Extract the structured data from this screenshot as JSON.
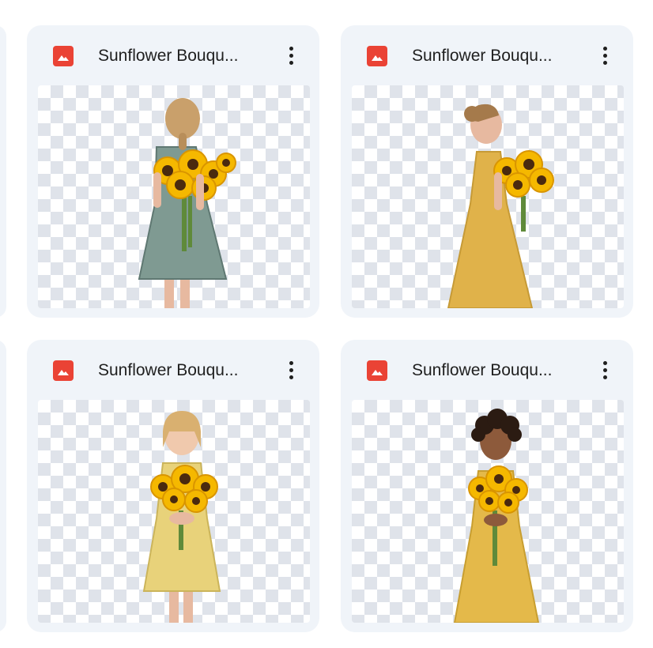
{
  "cards": [
    {
      "title": "Sunflower Bouqu...",
      "icon": "image-file-icon",
      "menu_icon": "more-vert-icon",
      "image": "girl-back-view-green-dress-sunflowers"
    },
    {
      "title": "Sunflower Bouqu...",
      "icon": "image-file-icon",
      "menu_icon": "more-vert-icon",
      "image": "girl-side-view-yellow-dress-sunflowers"
    },
    {
      "title": "Sunflower Bouqu...",
      "icon": "image-file-icon",
      "menu_icon": "more-vert-icon",
      "image": "blonde-girl-front-yellow-dress-sunflowers"
    },
    {
      "title": "Sunflower Bouqu...",
      "icon": "image-file-icon",
      "menu_icon": "more-vert-icon",
      "image": "curly-hair-girl-front-yellow-dress-sunflowers"
    }
  ],
  "colors": {
    "card_bg": "#f0f4f9",
    "icon_red": "#ea4335",
    "text": "#1f1f1f",
    "checker": "#dfe3ea"
  }
}
